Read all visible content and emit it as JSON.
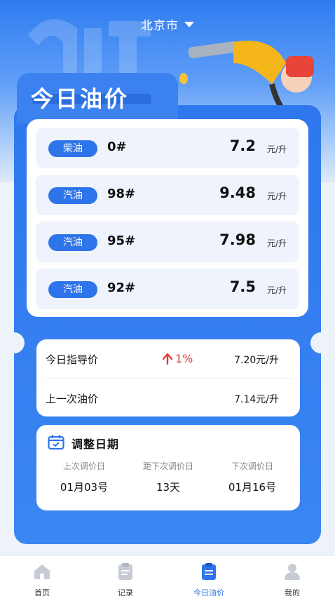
{
  "header": {
    "city": "北京市"
  },
  "hero": {
    "title": "今日油价"
  },
  "prices": [
    {
      "type": "柴油",
      "grade": "0#",
      "price": "7.2",
      "unit": "元/升"
    },
    {
      "type": "汽油",
      "grade": "98#",
      "price": "9.48",
      "unit": "元/升"
    },
    {
      "type": "汽油",
      "grade": "95#",
      "price": "7.98",
      "unit": "元/升"
    },
    {
      "type": "汽油",
      "grade": "92#",
      "price": "7.5",
      "unit": "元/升"
    }
  ],
  "guide": {
    "today_label": "今日指导价",
    "change": "1%",
    "today_value": "7.20元/升",
    "last_label": "上一次油价",
    "last_value": "7.14元/升"
  },
  "adjust": {
    "title": "调整日期",
    "cols": [
      {
        "label": "上次调价日",
        "value": "01月03号"
      },
      {
        "label": "距下次调价日",
        "value": "13天"
      },
      {
        "label": "下次调价日",
        "value": "01月16号"
      }
    ]
  },
  "tabbar": [
    {
      "label": "首页",
      "icon": "home-icon"
    },
    {
      "label": "记录",
      "icon": "clipboard-icon"
    },
    {
      "label": "今日油价",
      "icon": "fuel-list-icon"
    },
    {
      "label": "我的",
      "icon": "person-icon"
    }
  ],
  "colors": {
    "primary": "#2e74ea",
    "up": "#e23b3b"
  }
}
